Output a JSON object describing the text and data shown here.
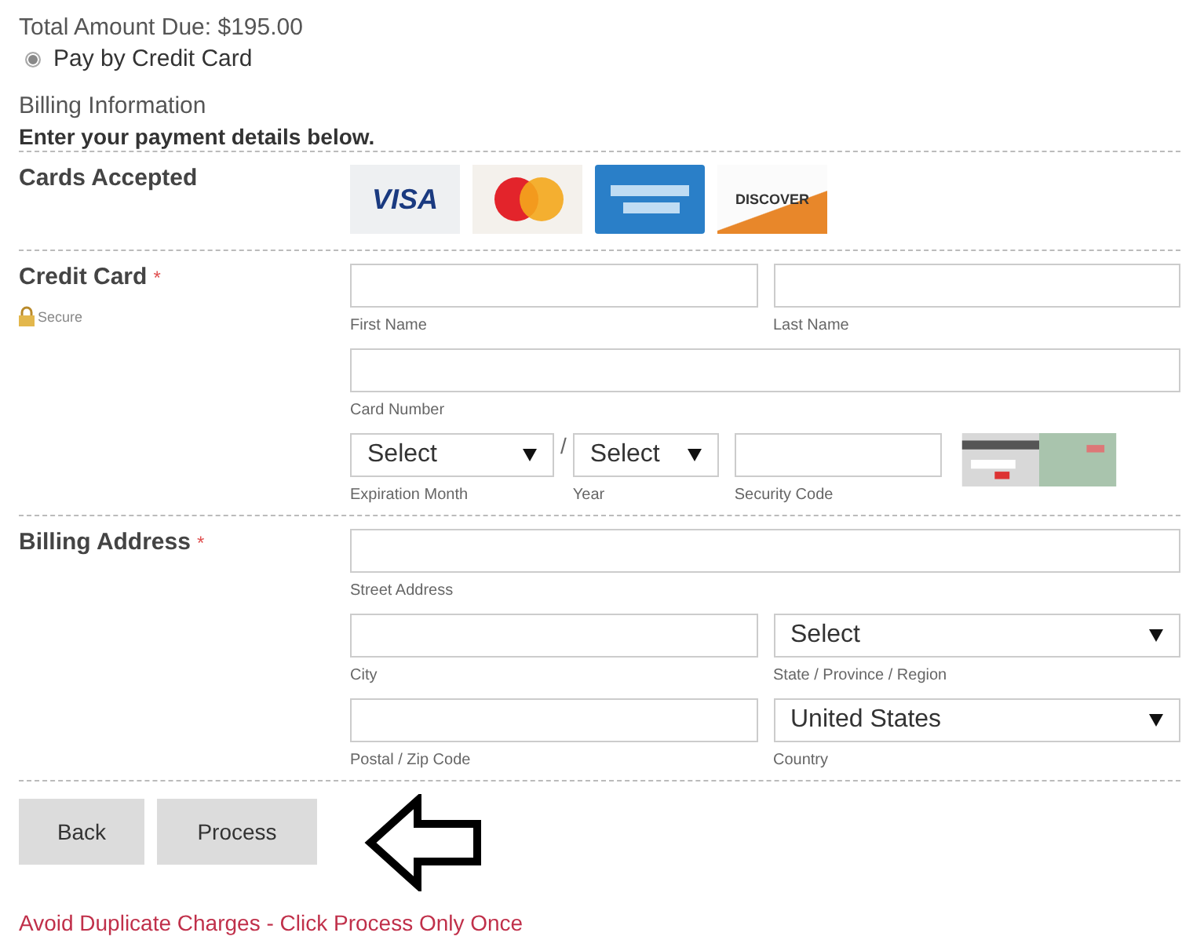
{
  "total": "Total Amount Due: $195.00",
  "payment_option": {
    "label": "Pay by Credit Card",
    "selected": true
  },
  "billing_title": "Billing Information",
  "instructions": "Enter your payment details below.",
  "cards_accepted": {
    "label": "Cards Accepted",
    "cards": [
      {
        "kind": "visa",
        "text": "VISA"
      },
      {
        "kind": "mastercard"
      },
      {
        "kind": "amex"
      },
      {
        "kind": "discover",
        "text": "DISCOVER"
      }
    ]
  },
  "credit_card": {
    "label": "Credit Card",
    "required_mark": "*",
    "secure": "Secure",
    "lines": [
      {
        "fields": [
          {
            "kind": "input",
            "caption": "First Name"
          },
          {
            "kind": "input",
            "caption": "Last Name"
          }
        ]
      },
      {
        "fields": [
          {
            "kind": "input",
            "caption": "Card Number"
          }
        ]
      },
      {
        "fields": [
          {
            "kind": "select",
            "value": "Select",
            "caption": "Expiration Month"
          },
          {
            "kind": "separator",
            "text": "/"
          },
          {
            "kind": "select",
            "value": "Select",
            "caption": "Year"
          },
          {
            "kind": "input",
            "caption": "Security Code"
          },
          {
            "kind": "cvv_image"
          }
        ]
      }
    ]
  },
  "billing_address": {
    "label": "Billing Address",
    "required_mark": "*",
    "lines": [
      {
        "fields": [
          {
            "kind": "input",
            "caption": "Street Address"
          }
        ]
      },
      {
        "fields": [
          {
            "kind": "input",
            "caption": "City"
          },
          {
            "kind": "select",
            "value": "Select",
            "caption": "State / Province / Region"
          }
        ]
      },
      {
        "fields": [
          {
            "kind": "input",
            "caption": "Postal / Zip Code"
          },
          {
            "kind": "select",
            "value": "United States",
            "caption": "Country"
          }
        ]
      }
    ]
  },
  "buttons": [
    "Back",
    "Process"
  ],
  "warning": "Avoid Duplicate Charges - Click Process Only Once"
}
